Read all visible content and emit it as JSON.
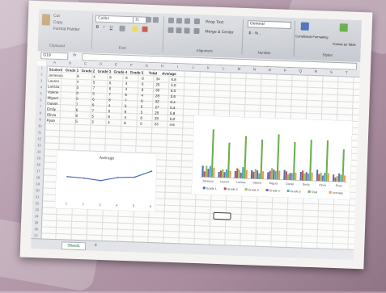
{
  "ribbon": {
    "cut": "Cut",
    "copy": "Copy",
    "format_painter": "Format Painter",
    "clipboard": "Clipboard",
    "font_name": "Calibri",
    "font_size": "11",
    "font_group": "Font",
    "alignment_group": "Alignment",
    "wrap_text": "Wrap Text",
    "merge_center": "Merge & Center",
    "number_format": "General",
    "number_group": "Number",
    "conditional_formatting": "Conditional Formatting",
    "format_as_table": "Format as Table",
    "styles_group": "Styles",
    "currency": "$ - % ,"
  },
  "formula_bar": {
    "name_box": "G18",
    "fx": "fx"
  },
  "columns": [
    "A",
    "B",
    "C",
    "D",
    "E",
    "F",
    "G",
    "H",
    "I",
    "J",
    "K",
    "L",
    "M",
    "N",
    "O",
    "P",
    "Q",
    "R",
    "S",
    "T"
  ],
  "rows": [
    "1",
    "2",
    "3",
    "4",
    "5",
    "6",
    "7",
    "8",
    "9",
    "10",
    "11",
    "12",
    "13",
    "14",
    "15",
    "16",
    "17",
    "18",
    "19",
    "20",
    "21",
    "22",
    "23",
    "24",
    "25",
    "26",
    "27"
  ],
  "table": {
    "headers": [
      "Student",
      "Grade 1",
      "Grade 2",
      "Grade 3",
      "Grade 4",
      "Grade 5",
      "Total",
      "Average"
    ],
    "rows": [
      [
        "Jameson",
        "8",
        "4",
        "8",
        "6",
        "8",
        "34",
        "6.8"
      ],
      [
        "Lauren",
        "4",
        "5",
        "6",
        "4",
        "6",
        "25",
        "5.0"
      ],
      [
        "Larissa",
        "5",
        "7",
        "6",
        "4",
        "8",
        "30",
        "6.0"
      ],
      [
        "Valerie",
        "6",
        "5",
        "7",
        "6",
        "4",
        "28",
        "5.6"
      ],
      [
        "Miguel",
        "5",
        "6",
        "8",
        "7",
        "6",
        "32",
        "6.4"
      ],
      [
        "Daniel",
        "7",
        "6",
        "4",
        "5",
        "5",
        "27",
        "5.4"
      ],
      [
        "Emily",
        "6",
        "7",
        "5",
        "6",
        "5",
        "29",
        "5.8"
      ],
      [
        "Olivia",
        "8",
        "5",
        "6",
        "4",
        "6",
        "29",
        "5.8"
      ],
      [
        "Ryan",
        "5",
        "3",
        "4",
        "6",
        "5",
        "23",
        "4.6"
      ]
    ]
  },
  "chart_data": [
    {
      "type": "line",
      "title": "Average",
      "x": [
        1,
        2,
        3,
        4,
        5,
        6
      ],
      "series": [
        {
          "values": [
            4.8,
            4.6,
            4.2,
            5.0,
            5.2,
            6.6
          ]
        }
      ],
      "ylim": [
        0,
        8
      ],
      "grid": false
    },
    {
      "type": "bar",
      "categories": [
        "Jameson",
        "Lauren",
        "Larissa",
        "Valerie",
        "Miguel",
        "Daniel",
        "Emily",
        "Olivia",
        "Ryan"
      ],
      "series": [
        {
          "name": "Grade 1",
          "values": [
            8,
            4,
            5,
            6,
            5,
            7,
            6,
            8,
            5
          ]
        },
        {
          "name": "Grade 2",
          "values": [
            4,
            5,
            7,
            5,
            6,
            6,
            7,
            5,
            3
          ]
        },
        {
          "name": "Grade 3",
          "values": [
            8,
            6,
            6,
            7,
            8,
            4,
            5,
            6,
            4
          ]
        },
        {
          "name": "Grade 4",
          "values": [
            6,
            4,
            4,
            6,
            7,
            5,
            6,
            4,
            6
          ]
        },
        {
          "name": "Grade 5",
          "values": [
            8,
            6,
            8,
            4,
            6,
            5,
            5,
            6,
            5
          ]
        },
        {
          "name": "Total",
          "values": [
            34,
            25,
            30,
            28,
            32,
            27,
            29,
            29,
            23
          ]
        },
        {
          "name": "Average",
          "values": [
            6.8,
            5.0,
            6.0,
            5.6,
            6.4,
            5.4,
            5.8,
            5.8,
            4.6
          ]
        }
      ],
      "ylim": [
        0,
        40
      ],
      "legend": "bottom",
      "grid": false
    }
  ],
  "colors": {
    "series": [
      "#4a6fb5",
      "#c0504d",
      "#9bbb59",
      "#8064a2",
      "#4bacc6",
      "#6ab04c",
      "#f79646"
    ]
  },
  "sheet": {
    "tab": "Sheet1",
    "add": "+"
  }
}
